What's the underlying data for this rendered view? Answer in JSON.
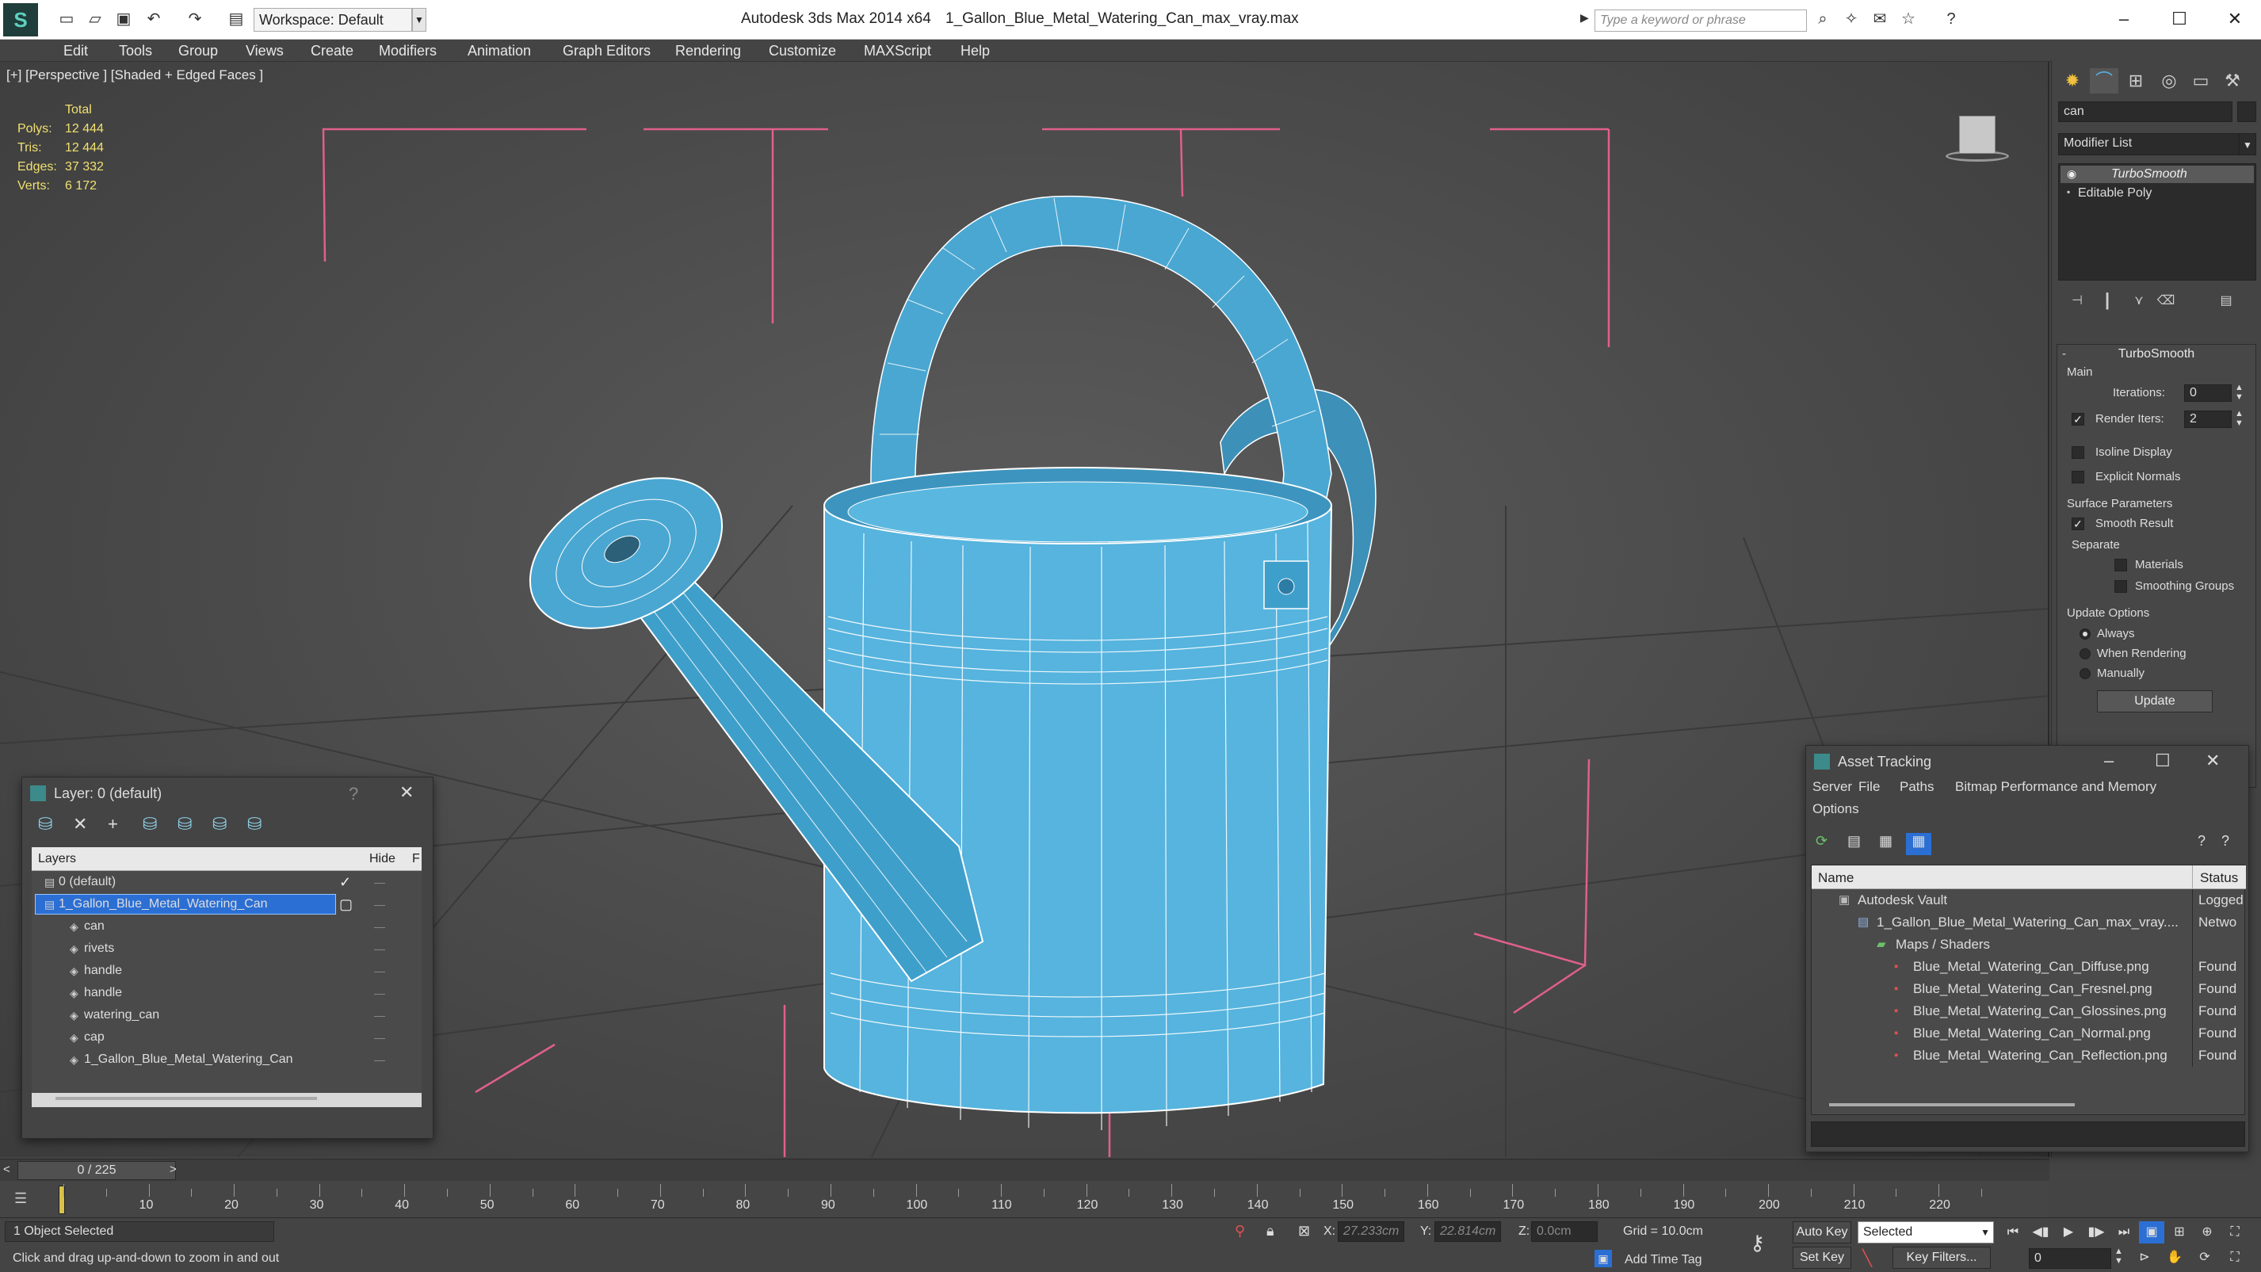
{
  "app": {
    "title": "Autodesk 3ds Max  2014 x64",
    "file": "1_Gallon_Blue_Metal_Watering_Can_max_vray.max",
    "workspace": "Workspace: Default",
    "search_placeholder": "Type a keyword or phrase"
  },
  "menu": [
    "Edit",
    "Tools",
    "Group",
    "Views",
    "Create",
    "Modifiers",
    "Animation",
    "Graph Editors",
    "Rendering",
    "Customize",
    "MAXScript",
    "Help"
  ],
  "viewport": {
    "label": "[+] [Perspective ] [Shaded + Edged Faces ]",
    "stats": {
      "header": "Total",
      "rows": [
        {
          "label": "Polys:",
          "value": "12 444"
        },
        {
          "label": "Tris:",
          "value": "12 444"
        },
        {
          "label": "Edges:",
          "value": "37 332"
        },
        {
          "label": "Verts:",
          "value": "6 172"
        }
      ]
    }
  },
  "command_panel": {
    "object_name": "can",
    "modifier_list": "Modifier List",
    "stack": [
      "TurboSmooth",
      "Editable Poly"
    ],
    "turbosmooth": {
      "title": "TurboSmooth",
      "main": "Main",
      "iterations_label": "Iterations:",
      "iterations": "0",
      "render_iters_label": "Render Iters:",
      "render_iters": "2",
      "isoline": "Isoline Display",
      "explicit": "Explicit Normals",
      "surface": "Surface Parameters",
      "smooth": "Smooth Result",
      "separate": "Separate",
      "materials": "Materials",
      "smoothing_groups": "Smoothing Groups",
      "update_options": "Update Options",
      "always": "Always",
      "when_rendering": "When Rendering",
      "manually": "Manually",
      "update": "Update"
    }
  },
  "layer_dialog": {
    "title": "Layer: 0 (default)",
    "help": "?",
    "col_layers": "Layers",
    "col_hide": "Hide",
    "col_f": "F",
    "rows": [
      {
        "name": "0 (default)",
        "level": 1
      },
      {
        "name": "1_Gallon_Blue_Metal_Watering_Can",
        "level": 1,
        "selected": true
      },
      {
        "name": "can",
        "level": 2
      },
      {
        "name": "rivets",
        "level": 2
      },
      {
        "name": "handle",
        "level": 2
      },
      {
        "name": "handle",
        "level": 2
      },
      {
        "name": "watering_can",
        "level": 2
      },
      {
        "name": "cap",
        "level": 2
      },
      {
        "name": "1_Gallon_Blue_Metal_Watering_Can",
        "level": 2
      }
    ]
  },
  "asset_dialog": {
    "title": "Asset Tracking",
    "menu": [
      "Server",
      "File",
      "Paths",
      "Bitmap Performance and Memory",
      "Options"
    ],
    "col_name": "Name",
    "col_status": "Status",
    "rows": [
      {
        "name": "Autodesk Vault",
        "status": "Logged",
        "level": 1
      },
      {
        "name": "1_Gallon_Blue_Metal_Watering_Can_max_vray....",
        "status": "Netwo",
        "level": 2
      },
      {
        "name": "Maps / Shaders",
        "status": "",
        "level": 3
      },
      {
        "name": "Blue_Metal_Watering_Can_Diffuse.png",
        "status": "Found",
        "level": 4
      },
      {
        "name": "Blue_Metal_Watering_Can_Fresnel.png",
        "status": "Found",
        "level": 4
      },
      {
        "name": "Blue_Metal_Watering_Can_Glossines.png",
        "status": "Found",
        "level": 4
      },
      {
        "name": "Blue_Metal_Watering_Can_Normal.png",
        "status": "Found",
        "level": 4
      },
      {
        "name": "Blue_Metal_Watering_Can_Reflection.png",
        "status": "Found",
        "level": 4
      }
    ]
  },
  "timeline": {
    "frame": "0 / 225",
    "ticks": [
      "10",
      "20",
      "30",
      "40",
      "50",
      "60",
      "70",
      "80",
      "90",
      "100",
      "110",
      "120",
      "130",
      "140",
      "150",
      "160",
      "170",
      "180",
      "190",
      "200",
      "210",
      "220"
    ],
    "last_tick": 225
  },
  "status": {
    "selected": "1 Object Selected",
    "prompt": "Click and drag up-and-down to zoom in and out",
    "x_label": "X:",
    "x": "27.233cm",
    "y_label": "Y:",
    "y": "22.814cm",
    "z_label": "Z:",
    "z": "0.0cm",
    "grid": "Grid = 10.0cm",
    "add_time_tag": "Add Time Tag",
    "auto_key": "Auto Key",
    "set_key": "Set Key",
    "selected_dd": "Selected",
    "key_filters": "Key Filters...",
    "frame": "0"
  },
  "colors": {
    "accent": "#2b6fd4",
    "can_blue": "#56b4de",
    "wire": "#ffffff",
    "bounds": "#e0608a"
  }
}
